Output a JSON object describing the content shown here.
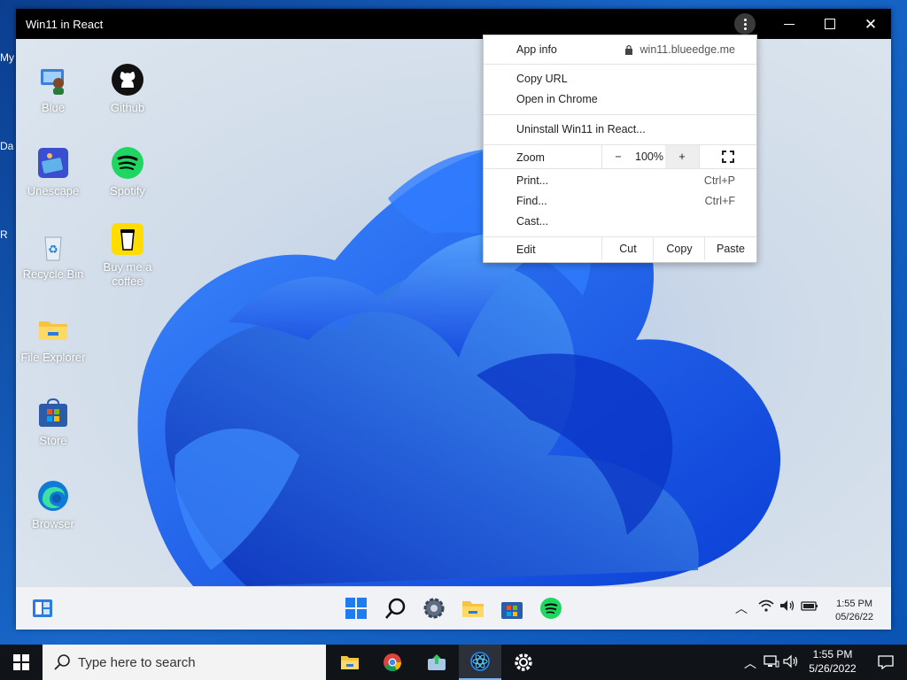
{
  "window": {
    "title": "Win11 in React",
    "controls": [
      "menu-icon",
      "minimize-icon",
      "maximize-icon",
      "close-icon"
    ]
  },
  "outer_desktop_peek": [
    "My",
    "Da",
    "R"
  ],
  "desktop_icons": [
    {
      "label": "Blue",
      "icon": "user-pc-icon"
    },
    {
      "label": "Github",
      "icon": "github-icon"
    },
    {
      "label": "Unescape",
      "icon": "unescape-icon"
    },
    {
      "label": "Spotify",
      "icon": "spotify-icon"
    },
    {
      "label": "Recycle Bin",
      "icon": "recycle-bin-icon"
    },
    {
      "label": "Buy me a coffee",
      "icon": "coffee-cup-icon"
    },
    {
      "label": "File Explorer",
      "icon": "folder-icon"
    },
    {
      "label": "Store",
      "icon": "store-icon"
    },
    {
      "label": "Browser",
      "icon": "edge-icon"
    }
  ],
  "win11_taskbar": {
    "left_icon": "widgets-icon",
    "apps": [
      "windows-start-icon",
      "search-icon",
      "settings-icon",
      "file-explorer-icon",
      "store-icon",
      "spotify-icon"
    ],
    "tray": [
      "chevron-up-icon",
      "wifi-icon",
      "volume-icon",
      "battery-icon"
    ],
    "time": "1:55 PM",
    "date": "05/26/22"
  },
  "context_menu": {
    "app_info": "App info",
    "site": "win11.blueedge.me",
    "copy_url": "Copy URL",
    "open_in_chrome": "Open in Chrome",
    "uninstall": "Uninstall Win11 in React...",
    "zoom_label": "Zoom",
    "zoom_minus": "−",
    "zoom_value": "100%",
    "zoom_plus": "+",
    "print": "Print...",
    "print_shortcut": "Ctrl+P",
    "find": "Find...",
    "find_shortcut": "Ctrl+F",
    "cast": "Cast...",
    "edit": "Edit",
    "cut": "Cut",
    "copy": "Copy",
    "paste": "Paste"
  },
  "outer_taskbar": {
    "search_placeholder": "Type here to search",
    "apps": [
      "file-explorer-icon",
      "chrome-icon",
      "app-installer-icon",
      "win11-react-icon",
      "settings-icon"
    ],
    "tray": [
      "chevron-up-icon",
      "network-icon",
      "volume-icon"
    ],
    "time": "1:55 PM",
    "date": "5/26/2022"
  },
  "colors": {
    "accent_blue": "#1a6ff0",
    "spotify_green": "#1ed760",
    "titlebar": "#000000"
  }
}
